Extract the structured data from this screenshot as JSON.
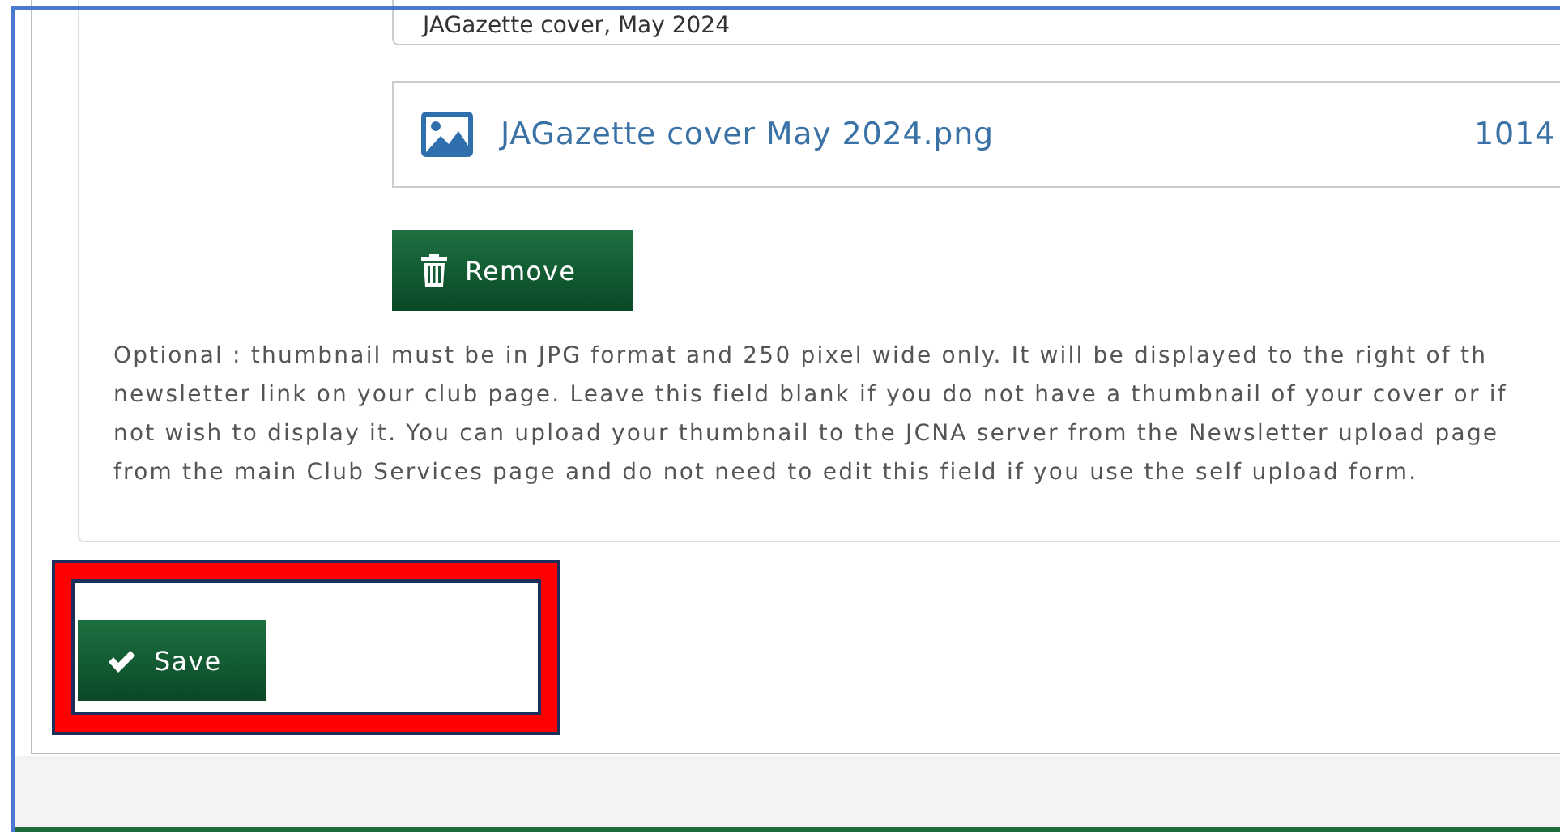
{
  "description_field": {
    "value": "JAGazette cover, May 2024"
  },
  "attachment": {
    "file_name": "JAGazette cover May 2024.png",
    "size": "1014"
  },
  "remove_button": {
    "label": "Remove"
  },
  "help_lines": [
    "Optional : thumbnail must be in JPG format and 250 pixel wide only. It will be displayed to the right of th",
    "newsletter link on your club page. Leave this field blank if you do not have a thumbnail of your cover or if",
    "not wish to display it. You can upload your thumbnail to the JCNA server from the Newsletter upload page",
    "from the main Club Services page and do not need to edit this field if you use the self upload form."
  ],
  "save_button": {
    "label": "Save",
    "highlighted": true
  }
}
